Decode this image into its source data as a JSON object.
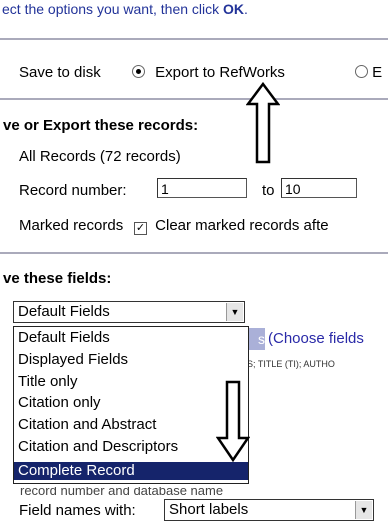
{
  "instruction": {
    "prefix": "ect the options you want, then click ",
    "bold": "OK",
    "suffix": "."
  },
  "destination": {
    "save_to_disk": "Save to disk",
    "export_refworks": "Export to RefWorks",
    "third_option": "E"
  },
  "records": {
    "heading": "ve or Export these records:",
    "all_records": "All Records (72 records)",
    "record_number_label": "Record number:",
    "from_value": "1",
    "to_label": "to",
    "to_value": "10",
    "marked_records": "Marked records",
    "clear_marked": "Clear marked records afte"
  },
  "fields": {
    "heading": "ve these fields:",
    "selected": "Default Fields",
    "options": [
      "Default Fields",
      "Displayed Fields",
      "Title only",
      "Citation only",
      "Citation and Abstract",
      "Citation and Descriptors",
      "Complete Record"
    ],
    "highlighted_option": "Complete Record",
    "behind_button_fragment": "s",
    "choose_fields": "(Choose fields",
    "fields_hint": "S; TITLE (TI); AUTHO",
    "hidden_fragment": "record number and database name",
    "field_names_label": "Field names with:",
    "field_names_value": "Short labels"
  },
  "colors": {
    "selection": "#15246b",
    "link": "#2a2aa8",
    "instruction": "#223399"
  }
}
